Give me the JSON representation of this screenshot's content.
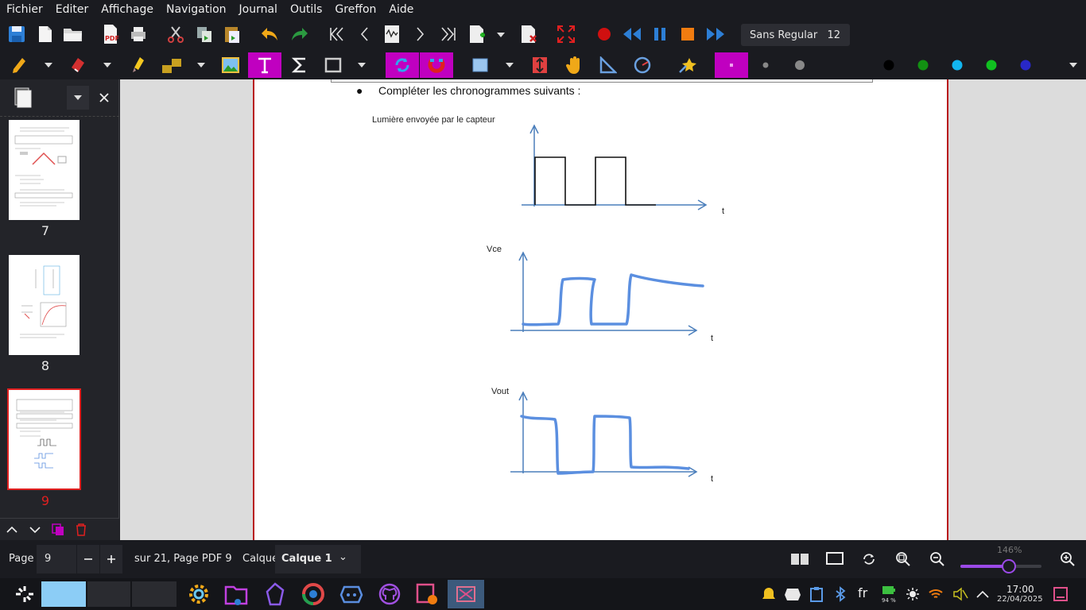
{
  "menu": [
    "Fichier",
    "Editer",
    "Affichage",
    "Navigation",
    "Journal",
    "Outils",
    "Greffon",
    "Aide"
  ],
  "toolbar": {
    "font_name": "Sans Regular",
    "font_size": "12",
    "icons_row1": [
      "save-icon",
      "new-page-icon",
      "open-icon",
      "export-pdf-icon",
      "print-icon",
      "cut-icon",
      "copy-icon",
      "paste-icon",
      "undo-icon",
      "redo-icon",
      "first-page-icon",
      "prev-page-icon",
      "page-preview-icon",
      "next-page-icon",
      "last-page-icon",
      "add-page-icon",
      "delete-page-icon",
      "fullscreen-icon",
      "record-icon",
      "rewind-icon",
      "pause-icon",
      "stop-icon",
      "fast-forward-icon"
    ],
    "colors": {
      "accent": "#c000c0",
      "record": "#d01010",
      "blue": "#2d7fd6",
      "stop": "#f07c10",
      "black": "#000000",
      "green": "#129012",
      "cyan": "#12b6f0",
      "lightgreen": "#10c020",
      "navy": "#2828c8"
    }
  },
  "sidebar": {
    "pages": [
      {
        "num": "7",
        "selected": false
      },
      {
        "num": "8",
        "selected": false
      },
      {
        "num": "9",
        "selected": true
      }
    ]
  },
  "document": {
    "bullet": "Compléter les chronogrammes suivants :",
    "label1": "Lumière envoyée par le capteur",
    "label_t": "t",
    "label_vce": "Vce",
    "label_vout": "Vout"
  },
  "status": {
    "page_label": "Page",
    "page_value": "9",
    "page_info": "sur 21, Page PDF 9",
    "layer_label": "Calque",
    "layer_value": "Calque 1",
    "zoom": "146%",
    "zoom_fraction": 0.6
  },
  "taskbar": {
    "battery": "94 %",
    "language": "fr",
    "time": "17:00",
    "date": "22/04/2025"
  }
}
